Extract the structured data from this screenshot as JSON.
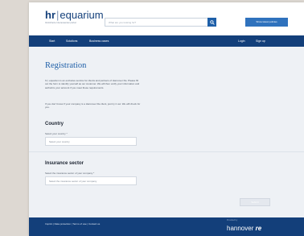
{
  "header": {
    "logo_hr": "hr",
    "logo_pipe": "|",
    "logo_name": "equarium",
    "logo_tagline": "Versicherte Interessenten portal",
    "search_placeholder": "What are you looking for?",
    "cta_label": "Show latest policies"
  },
  "nav": {
    "left": [
      "Start",
      "Solutions",
      "Business cases"
    ],
    "right": [
      "Login",
      "Sign up"
    ]
  },
  "main": {
    "title": "Registration",
    "intro_1": "hr | equarium is an exclusive service for clients and partners of Hannover Re. Please fill out the form to identify yourself as our customer. We will then verify your information and authorize your account if you meet these requirements.",
    "intro_2": "If you don't know if your company is a Hannover Re client, just try it out. We will check for you.",
    "country": {
      "heading": "Country",
      "label": "Select your country *",
      "placeholder": "Select your country"
    },
    "sector": {
      "heading": "Insurance sector",
      "label": "Select the insurance sector of your company *",
      "placeholder": "Select the insurance sector of your company"
    },
    "submit_label": "Submit"
  },
  "footer": {
    "links": "Imprint  |  Data protection  |  Terms of use  |  Contact us",
    "powered_by": "Provided by",
    "brand_1": "hannover",
    "brand_2": "re"
  },
  "colors": {
    "navy": "#133f7a",
    "accent_blue": "#1e5fa8",
    "content_bg": "#eef1f5"
  }
}
